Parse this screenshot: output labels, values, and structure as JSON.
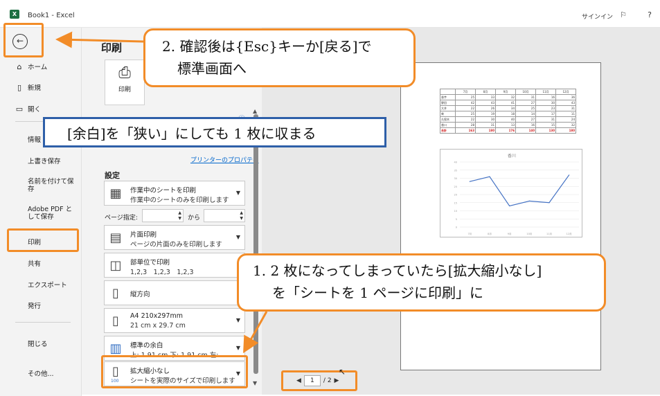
{
  "titlebar": {
    "app_title": "Book1 - Excel",
    "signin": "サインイン",
    "logo": "X",
    "help": "?"
  },
  "nav": {
    "back_icon": "arrow-left-circle-icon",
    "home": "ホーム",
    "new": "新規",
    "open": "開く",
    "info": "情報",
    "save": "上書き保存",
    "save_as": "名前を付けて保存",
    "adobe": "Adobe PDF として保存",
    "print": "印刷",
    "share": "共有",
    "export": "エクスポート",
    "publish": "発行",
    "close": "閉じる",
    "more": "その他..."
  },
  "print_pane": {
    "title": "印刷",
    "print_button": "印刷",
    "printer_properties": "プリンターのプロパティ",
    "settings_label": "設定",
    "page_range_label": "ページ指定:",
    "to_label": "から",
    "settings": [
      {
        "l1": "作業中のシートを印刷",
        "l2": "作業中のシートのみを印刷します"
      },
      {
        "l1": "片面印刷",
        "l2": "ページの片面のみを印刷します"
      },
      {
        "l1": "部単位で印刷",
        "l2": "1,2,3　1,2,3　1,2,3"
      },
      {
        "l1": "縦方向",
        "l2": ""
      },
      {
        "l1": "A4 210x297mm",
        "l2": "21 cm x 29.7 cm"
      },
      {
        "l1": "標準の余白",
        "l2": "上: 1.91 cm 下: 1.91 cm 左:…"
      },
      {
        "l1": "拡大縮小なし",
        "l2": "シートを実際のサイズで印刷します"
      }
    ],
    "scale_icon_text": "100"
  },
  "preview": {
    "page_current": "1",
    "page_total": "/ 2",
    "table_headers": [
      "",
      "7月",
      "8月",
      "9月",
      "10月",
      "11月",
      "12月"
    ],
    "table_rows": [
      [
        "香芋",
        "25",
        "33",
        "32",
        "31",
        "16",
        "36"
      ],
      [
        "野田",
        "42",
        "43",
        "41",
        "27",
        "30",
        "43"
      ],
      [
        "大井",
        "22",
        "26",
        "34",
        "25",
        "23",
        "31"
      ],
      [
        "柴",
        "25",
        "19",
        "18",
        "14",
        "17",
        "11"
      ],
      [
        "久保木",
        "22",
        "30",
        "40",
        "27",
        "31",
        "24"
      ],
      [
        "香川",
        "28",
        "31",
        "13",
        "16",
        "15",
        "32"
      ]
    ],
    "table_total": [
      "合計",
      "163",
      "180",
      "176",
      "140",
      "130",
      "180"
    ],
    "chart_title": "香川"
  },
  "chart_data": {
    "type": "line",
    "title": "香川",
    "categories": [
      "7月",
      "8月",
      "9月",
      "10月",
      "11月",
      "12月"
    ],
    "series": [
      {
        "name": "香川",
        "values": [
          28,
          31,
          13,
          16,
          15,
          32
        ]
      }
    ],
    "ylim": [
      0,
      40
    ]
  },
  "callouts": {
    "c1_line1": "2. 確認後は{Esc}キーか[戻る]で",
    "c1_line2": "標準画面へ",
    "c2_line1": "1. 2 枚になってしまっていたら[拡大縮小なし]",
    "c2_line2": "を「シートを 1 ページに印刷」に",
    "blue": "[余白]を「狭い」にしても 1 枚に収まる"
  },
  "colors": {
    "accent_orange": "#f28c28",
    "accent_blue": "#2e5fa8",
    "excel_green": "#1d6f42"
  }
}
